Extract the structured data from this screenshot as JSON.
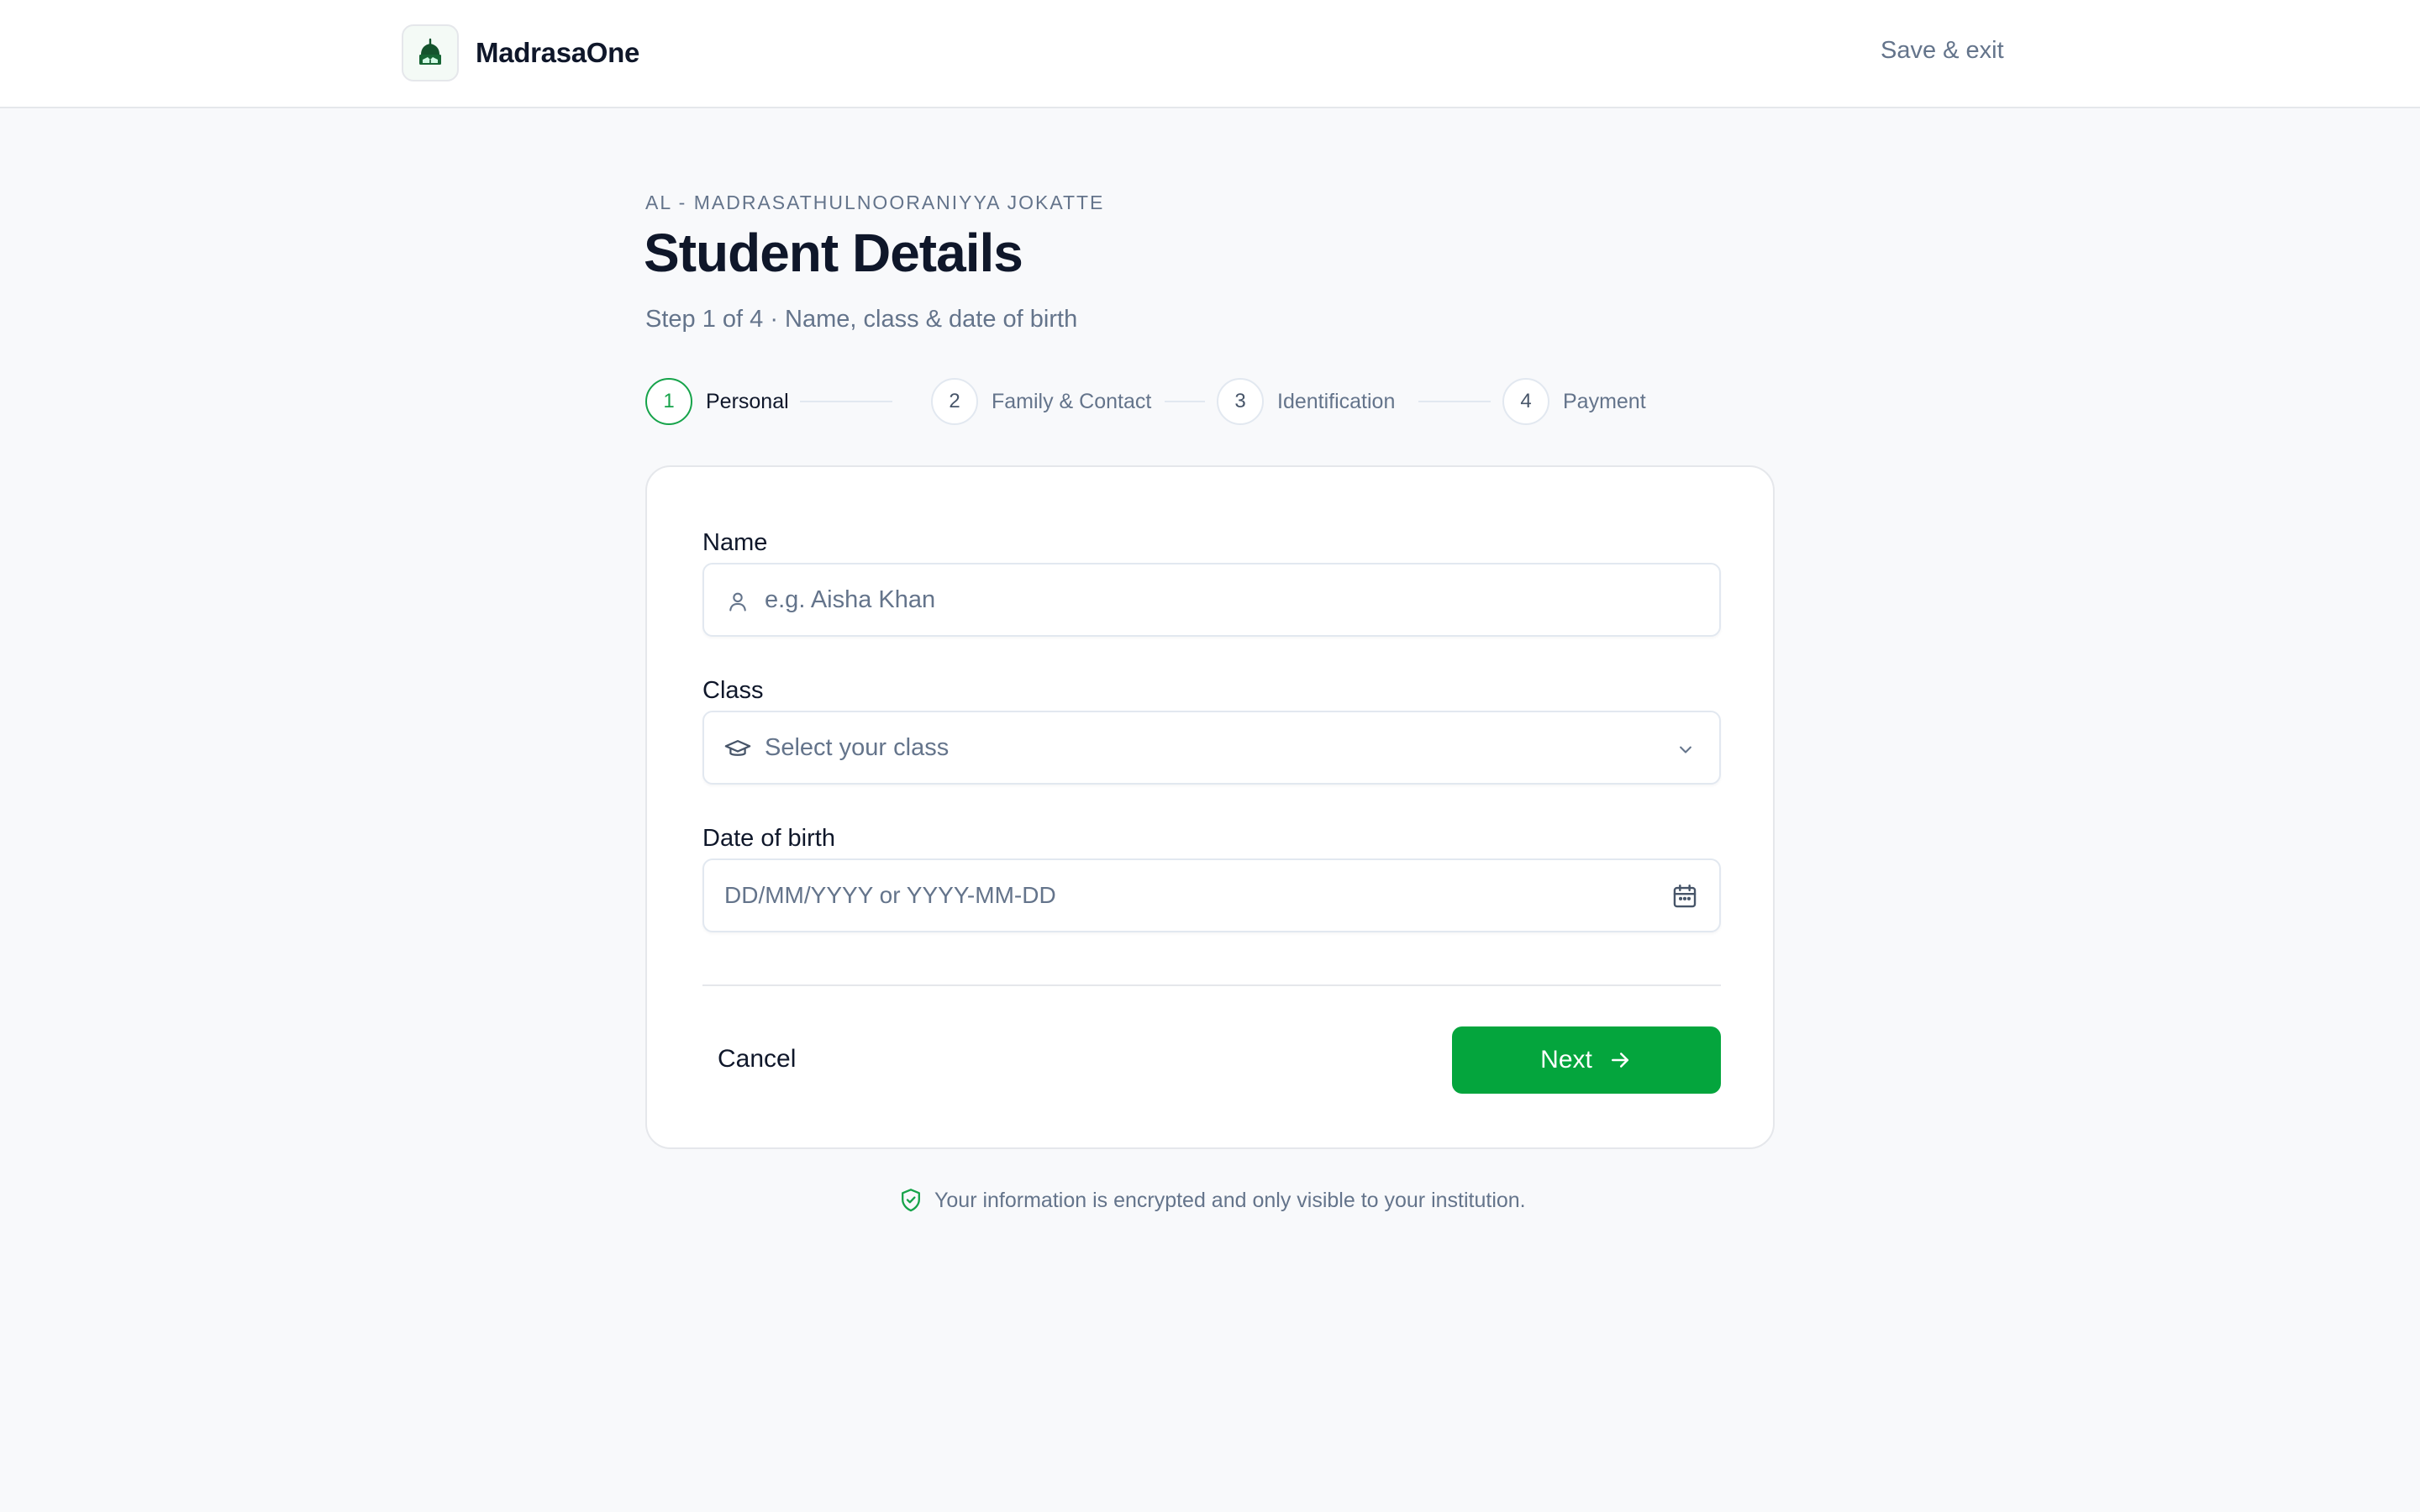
{
  "header": {
    "brand_name": "MadrasaOne",
    "save_exit_label": "Save & exit",
    "colors": {
      "brand_green": "#16a34a",
      "logo_dark": "#14532d"
    }
  },
  "page": {
    "institution": "AL - MADRASATHULNOORANIYYA JOKATTE",
    "title": "Student Details",
    "subtitle": "Step 1 of 4 · Name, class & date of birth"
  },
  "stepper": {
    "steps": [
      {
        "number": "1",
        "label": "Personal",
        "state": "active"
      },
      {
        "number": "2",
        "label": "Family & Contact",
        "state": "pending"
      },
      {
        "number": "3",
        "label": "Identification",
        "state": "pending"
      },
      {
        "number": "4",
        "label": "Payment",
        "state": "pending"
      }
    ]
  },
  "form": {
    "name": {
      "label": "Name",
      "placeholder": "e.g. Aisha Khan",
      "value": "",
      "icon": "user-icon"
    },
    "class": {
      "label": "Class",
      "placeholder": "Select your class",
      "value": "",
      "icon": "graduation-cap-icon"
    },
    "dob": {
      "label": "Date of birth",
      "placeholder": "DD/MM/YYYY or YYYY-MM-DD",
      "value": "",
      "icon": "calendar-icon"
    },
    "cancel_label": "Cancel",
    "next_label": "Next",
    "next_color": "#04a53d"
  },
  "footer": {
    "note": "Your information is encrypted and only visible to your institution.",
    "icon": "shield-check-icon"
  }
}
